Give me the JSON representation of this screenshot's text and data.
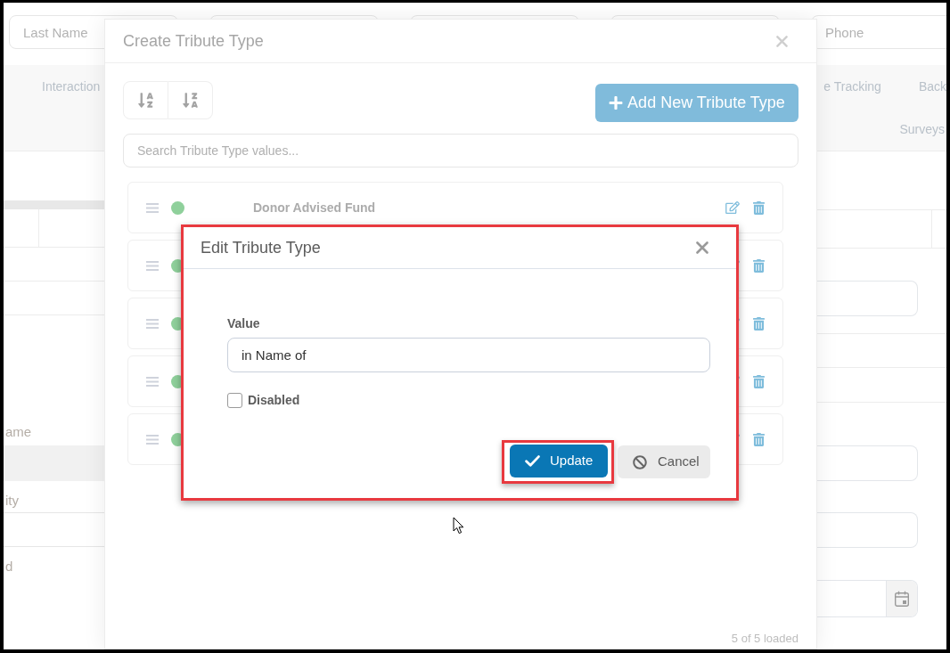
{
  "background": {
    "filters": [
      {
        "placeholder": "Last Name"
      },
      {
        "placeholder": "Phone"
      }
    ],
    "tabs": [
      {
        "label": "Interaction",
        "selected": false
      },
      {
        "label": "e Tracking",
        "selected": false
      },
      {
        "label": "Back",
        "selected": false
      },
      {
        "label": "Surveys",
        "selected": false
      }
    ],
    "form_fields": [
      {
        "label": "ame",
        "kind": "readonly"
      },
      {
        "label": "ity",
        "kind": "text"
      },
      {
        "label": "d",
        "kind": "label"
      }
    ]
  },
  "create_dialog": {
    "title": "Create Tribute Type",
    "add_button": "Add New Tribute Type",
    "search": {
      "placeholder": "Search Tribute Type values..."
    },
    "items": [
      {
        "label": "Donor Advised Fund",
        "active": true
      },
      {
        "active": true
      },
      {
        "active": true
      },
      {
        "active": true
      },
      {
        "active": true
      }
    ],
    "footer": "5 of 5 loaded"
  },
  "edit_dialog": {
    "title": "Edit Tribute Type",
    "highlighted": true,
    "field": {
      "label": "Value",
      "value": "in Name of"
    },
    "checkbox": {
      "label": "Disabled",
      "checked": false
    },
    "buttons": [
      {
        "label": "Update",
        "kind": "confirm",
        "highlighted": true
      },
      {
        "label": "Cancel",
        "kind": "cancel",
        "highlighted": false
      }
    ]
  }
}
